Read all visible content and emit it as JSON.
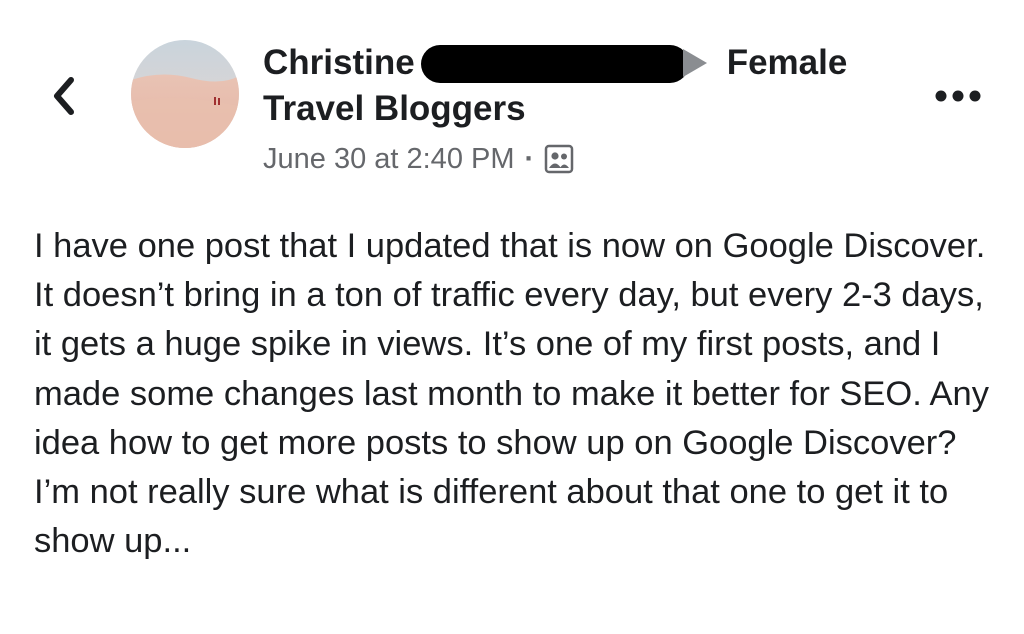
{
  "post": {
    "author_name": "Christine",
    "author_gender": "Female",
    "group_name": "Travel Bloggers",
    "timestamp": "June 30 at 2:40 PM",
    "separator": "·",
    "body": "I have one post that I updated that is now on Google Discover. It doesn’t bring in a ton of traffic every day, but every 2-3 days, it gets a huge spike in views. It’s one of my first posts, and I made some changes last month to make it better for SEO. Any idea how to get more posts to show up on Google Discover? I’m not really sure what is different about that one to get it to show up..."
  },
  "icons": {
    "back": "chevron-left-icon",
    "more": "more-dots-icon",
    "privacy": "group-members-icon",
    "arrow": "arrow-right-icon"
  },
  "colors": {
    "text_primary": "#1c1e21",
    "text_secondary": "#65676b",
    "arrow": "#8a8d91",
    "redaction": "#000000"
  }
}
